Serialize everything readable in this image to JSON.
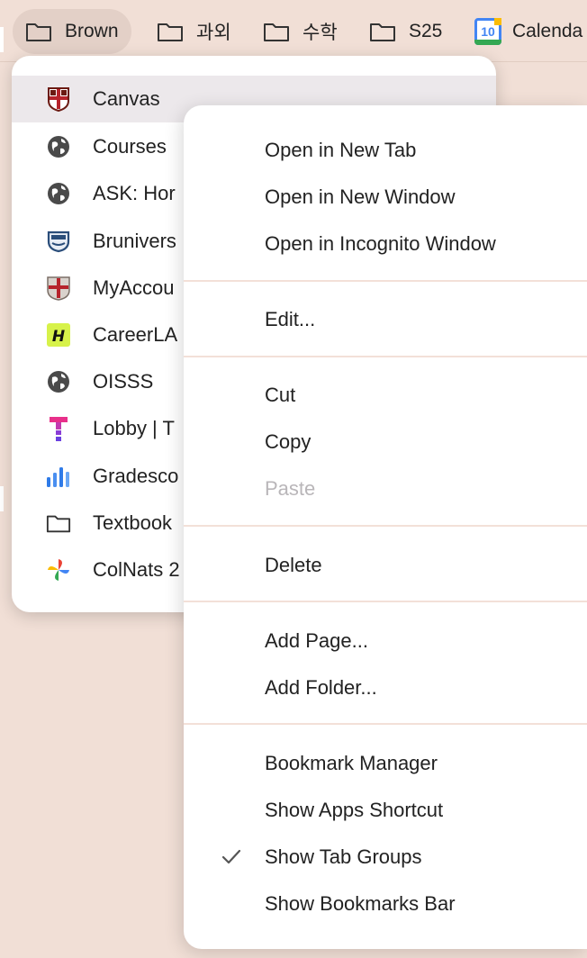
{
  "bookmarks_bar": {
    "items": [
      {
        "label": "Brown",
        "icon": "folder-icon"
      },
      {
        "label": "과외",
        "icon": "folder-icon"
      },
      {
        "label": "수학",
        "icon": "folder-icon"
      },
      {
        "label": "S25",
        "icon": "folder-icon"
      },
      {
        "label": "Calenda",
        "icon": "calendar-icon",
        "badge": "10"
      }
    ]
  },
  "folder_menu": {
    "items": [
      {
        "label": "Canvas",
        "icon": "crest-icon"
      },
      {
        "label": "Courses",
        "icon": "globe-icon"
      },
      {
        "label": "ASK: Hor",
        "icon": "globe-icon"
      },
      {
        "label": "Brunivers",
        "icon": "shield-icon"
      },
      {
        "label": "MyAccou",
        "icon": "crest-icon"
      },
      {
        "label": "CareerLA",
        "icon": "handshake-logo-icon"
      },
      {
        "label": "OISSS",
        "icon": "globe-icon"
      },
      {
        "label": "Lobby | T",
        "icon": "top-hat-logo-icon"
      },
      {
        "label": "Gradesco",
        "icon": "bar-chart-icon"
      },
      {
        "label": "Textbook",
        "icon": "folder-icon"
      },
      {
        "label": "ColNats 2",
        "icon": "pinwheel-icon"
      }
    ]
  },
  "context_menu": {
    "open_new_tab": "Open in New Tab",
    "open_new_window": "Open in New Window",
    "open_incognito": "Open in Incognito Window",
    "edit": "Edit...",
    "cut": "Cut",
    "copy": "Copy",
    "paste": "Paste",
    "delete": "Delete",
    "add_page": "Add Page...",
    "add_folder": "Add Folder...",
    "bookmark_manager": "Bookmark Manager",
    "show_apps_shortcut": "Show Apps Shortcut",
    "show_tab_groups": "Show Tab Groups",
    "show_bookmarks_bar": "Show Bookmarks Bar"
  },
  "colors": {
    "background": "#f1dfd6",
    "menu": "#ffffff",
    "hover": "#ece8eb",
    "disabled_text": "#b9b6b9"
  }
}
